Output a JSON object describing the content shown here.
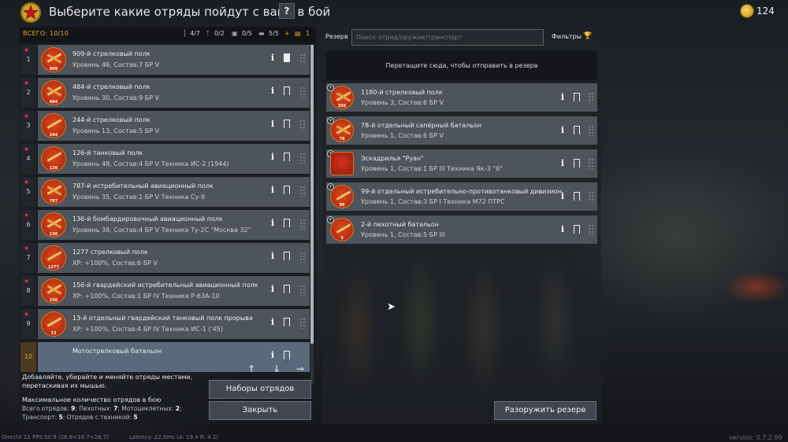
{
  "header": {
    "title": "Выберите какие отряды пойдут с вами в бой",
    "help_label": "?",
    "gold": "124"
  },
  "left": {
    "total_label": "ВСЕГО: 10/10",
    "stats": [
      {
        "icon": "infantry-icon",
        "value": "4/7"
      },
      {
        "icon": "radio-icon",
        "value": "0/2"
      },
      {
        "icon": "vehicle-icon",
        "value": "0/5"
      },
      {
        "icon": "tank-icon",
        "value": "5/5"
      },
      {
        "icon": "plus-icon",
        "value": "+"
      },
      {
        "icon": "car-icon",
        "value": "1"
      }
    ],
    "squads": [
      {
        "num": "1",
        "name": "909-й стрелковый полк",
        "info": "Уровень 46, Состав:7  БР V",
        "level": "909",
        "bookmarked": true
      },
      {
        "num": "2",
        "name": "484-й стрелковый полк",
        "info": "Уровень 30, Состав:9  БР V",
        "level": "484",
        "bookmarked": false
      },
      {
        "num": "3",
        "name": "244-й стрелковый полк",
        "info": "Уровень 13, Состав:5  БР V",
        "level": "244",
        "bookmarked": false
      },
      {
        "num": "4",
        "name": "126-й танковый полк",
        "info": "Уровень 48, Состав:4  БР V  Техника ИС-2 (1944)",
        "level": "126",
        "bookmarked": false
      },
      {
        "num": "5",
        "name": "787-й истребительный авиационный полк",
        "info": "Уровень 35, Состав:1  БР V  Техника Су-9",
        "level": "787",
        "bookmarked": false
      },
      {
        "num": "6",
        "name": "136-й бомбардировочный авиационный полк",
        "info": "Уровень 38, Состав:4  БР V  Техника Ту-2С \"Москва 32\"",
        "level": "136",
        "bookmarked": false
      },
      {
        "num": "7",
        "name": "1277 стрелковый полк",
        "info": "XP: +100%, Состав:6  БР V",
        "level": "1277",
        "bookmarked": false
      },
      {
        "num": "8",
        "name": "156-й гвардейский истребительный авиационный полк",
        "info": "XP: +100%, Состав:1  БР IV  Техника Р-63А-10",
        "level": "156",
        "bookmarked": false
      },
      {
        "num": "9",
        "name": "13-й отдельный гвардейский танковый полк прорыва",
        "info": "XP: +100%, Состав:4  БР IV  Техника ИС-1 ('45)",
        "level": "13",
        "bookmarked": false
      },
      {
        "num": "10",
        "name": "Мотострелковый батальон",
        "info": "",
        "level": "",
        "bookmarked": false
      }
    ],
    "hint": "Добавляйте, убирайте и меняйте отряды местами, перетаскивая их мышью.",
    "max_label": "Максимальное количество отрядов в бою",
    "summary1": {
      "label_a": "Всего отрядов: ",
      "val_a": "9",
      "label_b": "; Пехотных: ",
      "val_b": "7",
      "label_c": "; Мотоциклетных: ",
      "val_c": "2",
      "end": ";"
    },
    "summary2": {
      "label_a": "Транспорт: ",
      "val_a": "5",
      "label_b": "; Отрядов с техникой: ",
      "val_b": "5"
    },
    "presets_button": "Наборы отрядов",
    "close_button": "Закрыть"
  },
  "right": {
    "reserve_label": "Резерв",
    "search_placeholder": "Поиск отряд/оружие/транспорт",
    "filters_label": "Фильтры",
    "drop_zone": "Перетащите сюда, чтобы отправить в резерв",
    "squads": [
      {
        "name": "1180-й стрелковый полк",
        "info": "Уровень 3, Состав:6  БР V",
        "level": "356"
      },
      {
        "name": "78-й отдельный сапёрный батальон",
        "info": "Уровень 1, Состав:6  БР V",
        "level": "78"
      },
      {
        "name": "Эскадрилья \"Руан\"",
        "info": "Уровень 1, Состав:1  БР III  Техника Як-3 \"6\"",
        "level": ""
      },
      {
        "name": "99-й отдельный истребительно-противотанковый дивизион",
        "info": "Уровень 1, Состав:3  БР I  Техника М72 ПТРС",
        "level": "99"
      },
      {
        "name": "2-й пехотный батальон",
        "info": "Уровень 1, Состав:5  БР III",
        "level": "3"
      }
    ],
    "disarm_button": "Разоружить резерв"
  },
  "footer": {
    "fps": "DirectX 11 FPS:50.9 (16.8<16.7<16.7)",
    "latency": "Latency: 22.0ms (A: 19.4 R: 4.2)",
    "version": "version: 0.7.2.99"
  }
}
